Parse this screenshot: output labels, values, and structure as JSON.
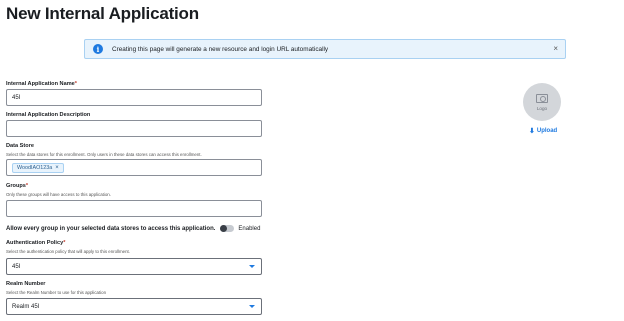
{
  "page": {
    "title": "New Internal Application"
  },
  "banner": {
    "text": "Creating this page will generate a new resource and login URL automatically",
    "info_glyph": "i",
    "close_glyph": "×"
  },
  "form": {
    "name": {
      "label": "Internal Application Name",
      "required": "*",
      "value": "45I"
    },
    "description": {
      "label": "Internal Application Description",
      "value": ""
    },
    "data_store": {
      "label": "Data Store",
      "help": "Select the data stores for this enrollment. Only users in these data stores can access this enrollment.",
      "chips": [
        {
          "label": "WoodIAO123a",
          "remove_glyph": "×"
        }
      ]
    },
    "groups": {
      "label": "Groups",
      "required": "*",
      "help": "Only these groups will have access to this application.",
      "value": ""
    },
    "allow_all_groups": {
      "label": "Allow every group in your selected data stores to access this application.",
      "state": "Enabled"
    },
    "auth_policy": {
      "label": "Authentication Policy",
      "required": "*",
      "help": "Select the authentication policy that will apply to this enrollment.",
      "value": "45I"
    },
    "realm": {
      "label": "Realm Number",
      "help": "Select the Realm Number to use for this application",
      "value": "Realm 45I"
    }
  },
  "logo": {
    "placeholder": "Logo",
    "upload_label": "Upload",
    "upload_glyph": "⬇"
  },
  "colors": {
    "accent": "#1f7ae0",
    "banner_bg": "#e8f3fc",
    "required": "#c0392b"
  }
}
